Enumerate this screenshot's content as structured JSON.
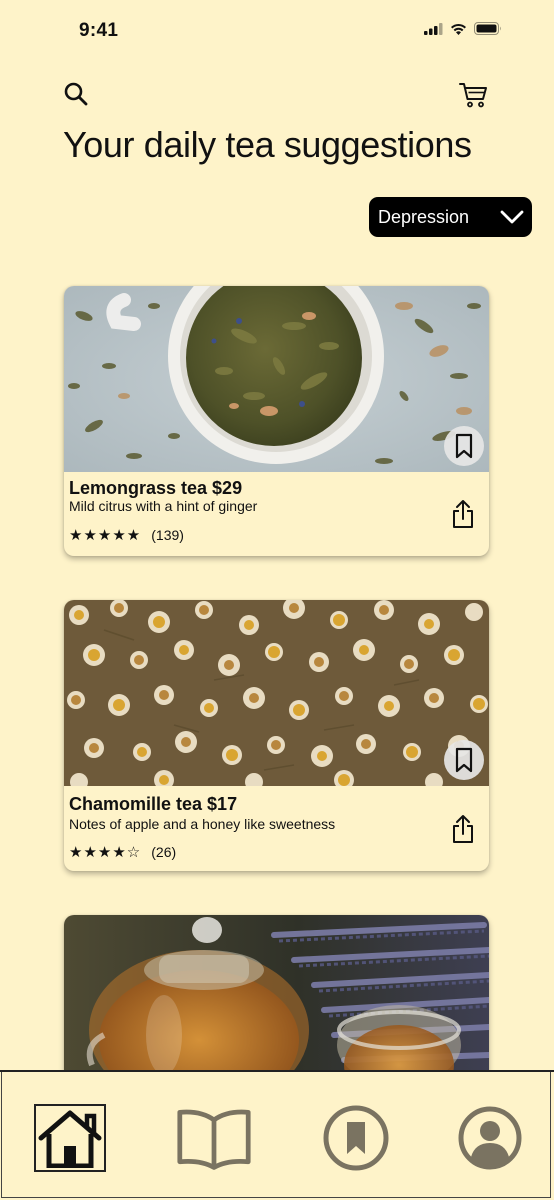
{
  "status_bar": {
    "time": "9:41"
  },
  "header": {
    "title": "Your daily tea suggestions",
    "search_icon": "search-icon",
    "cart_icon": "cart-icon"
  },
  "filter": {
    "selected": "Depression"
  },
  "products": [
    {
      "name": "Lemongrass tea $29",
      "description": "Mild citrus with a hint of ginger",
      "stars": "★★★★★",
      "rating": 5,
      "reviews": "(139)"
    },
    {
      "name": "Chamomille tea $17",
      "description": "Notes of apple and a honey like sweetness",
      "stars": "★★★★☆",
      "rating": 4,
      "reviews": "(26)"
    }
  ],
  "tab_bar": {
    "items": [
      "home-icon",
      "book-icon",
      "bookmark-icon",
      "profile-icon"
    ],
    "active": "home-icon"
  },
  "colors": {
    "background": "#FEF3C9",
    "dropdown": "#000000",
    "icon_gray": "#7A7361"
  }
}
